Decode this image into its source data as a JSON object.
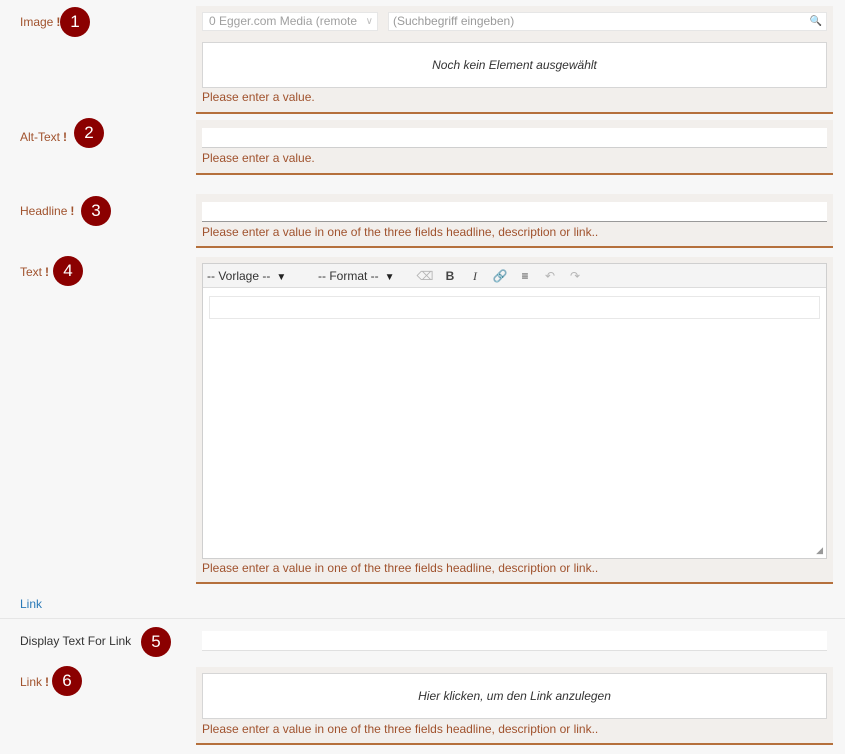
{
  "fields": {
    "image": {
      "label": "Image",
      "required_mark": "!",
      "badge": "1",
      "media_source": "0 Egger.com Media (remote",
      "search_placeholder": "(Suchbegriff eingeben)",
      "empty_text": "Noch kein Element ausgewählt",
      "error": "Please enter a value."
    },
    "alt_text": {
      "label": "Alt-Text",
      "required_mark": "!",
      "badge": "2",
      "value": "",
      "error": "Please enter a value."
    },
    "headline": {
      "label": "Headline",
      "required_mark": "!",
      "badge": "3",
      "value": "",
      "error": "Please enter a value in one of the three fields headline, description or link.."
    },
    "text": {
      "label": "Text",
      "required_mark": "!",
      "badge": "4",
      "template_select": "-- Vorlage --",
      "format_select": "-- Format --",
      "error": "Please enter a value in one of the three fields headline, description or link.."
    },
    "link_section": {
      "title": "Link"
    },
    "display_text": {
      "label": "Display Text For Link",
      "badge": "5",
      "value": ""
    },
    "link": {
      "label": "Link",
      "required_mark": "!",
      "badge": "6",
      "placeholder": "Hier klicken, um den Link anzulegen",
      "error": "Please enter a value in one of the three fields headline, description or link.."
    }
  },
  "toolbar_icons": [
    "eraser-icon",
    "bold-icon",
    "italic-icon",
    "link-icon",
    "list-icon",
    "undo-icon",
    "redo-icon"
  ],
  "toolbar_glyphs": {
    "bold": "B",
    "italic": "I"
  },
  "colors": {
    "error_text": "#a0522d",
    "error_border": "#b5703c",
    "badge": "#8b0000",
    "section_link": "#2a7ab8",
    "field_bg": "#f2efec"
  }
}
